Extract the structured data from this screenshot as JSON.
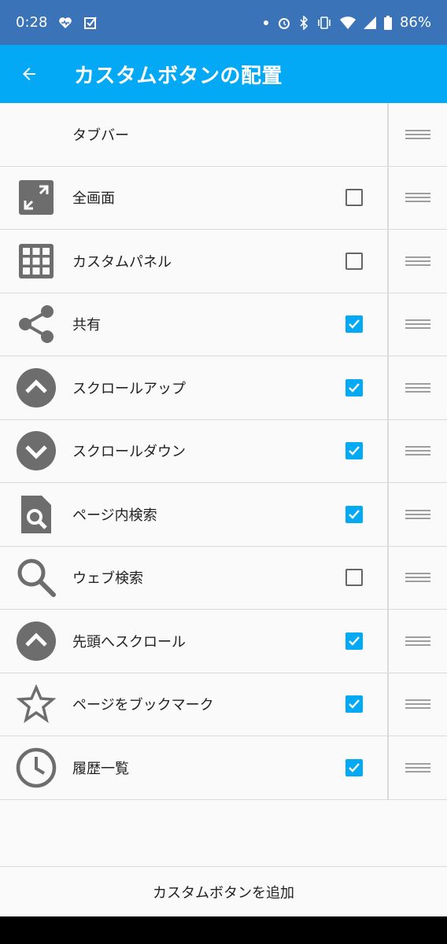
{
  "status_bar": {
    "time": "0:28",
    "battery": "86%"
  },
  "app_bar": {
    "title": "カスタムボタンの配置"
  },
  "items": [
    {
      "label": "タブバー",
      "icon": "none",
      "checked": null
    },
    {
      "label": "全画面",
      "icon": "fullscreen-icon",
      "checked": false
    },
    {
      "label": "カスタムパネル",
      "icon": "grid-icon",
      "checked": false
    },
    {
      "label": "共有",
      "icon": "share-icon",
      "checked": true
    },
    {
      "label": "スクロールアップ",
      "icon": "scroll-up-icon",
      "checked": true
    },
    {
      "label": "スクロールダウン",
      "icon": "scroll-down-icon",
      "checked": true
    },
    {
      "label": "ページ内検索",
      "icon": "find-in-page-icon",
      "checked": true
    },
    {
      "label": "ウェブ検索",
      "icon": "search-icon",
      "checked": false
    },
    {
      "label": "先頭へスクロール",
      "icon": "scroll-top-icon",
      "checked": true
    },
    {
      "label": "ページをブックマーク",
      "icon": "star-icon",
      "checked": true
    },
    {
      "label": "履歴一覧",
      "icon": "clock-icon",
      "checked": true
    }
  ],
  "add_button_label": "カスタムボタンを追加",
  "colors": {
    "status_bar": "#3a73b8",
    "app_bar": "#03a9f4",
    "checkbox_on": "#03a9f4",
    "icon": "#6d6d6d"
  }
}
